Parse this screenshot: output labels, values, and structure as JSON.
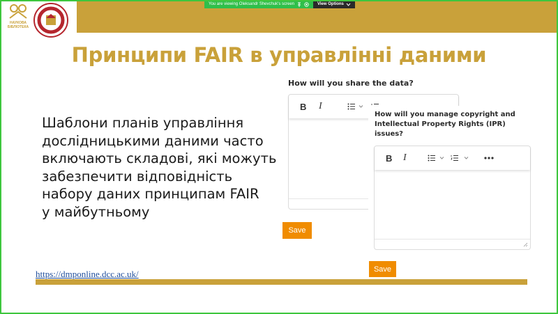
{
  "zoom_bar": {
    "viewing_text": "You are viewing  Oleksandr Shevchuk's screen",
    "view_options_label": "View Options"
  },
  "logos": {
    "library_text_line1": "НАУКОВА",
    "library_text_line2": "БІБЛІОТЕКА"
  },
  "slide": {
    "title": "Принципи FAIR в управлінні даними",
    "body_lines": [
      "Шаблони планів управління",
      "дослідницькими даними часто",
      "включають складові, які можуть",
      "забезпечити відповідність",
      "набору даних принципам FAIR",
      "у майбутньому"
    ],
    "source_link": "https://dmponline.dcc.ac.uk/"
  },
  "form1": {
    "question": "How will you share the data?",
    "save_label": "Save"
  },
  "form2": {
    "question": "How will you manage copyright and Intellectual Property Rights (IPR) issues?",
    "save_label": "Save"
  },
  "toolbar": {
    "bold_label": "B",
    "italic_label": "I"
  },
  "colors": {
    "accent_gold": "#c9a13a",
    "save_orange": "#f08c00",
    "share_border_green": "#3ec63e",
    "link_blue": "#1f4e9c"
  }
}
